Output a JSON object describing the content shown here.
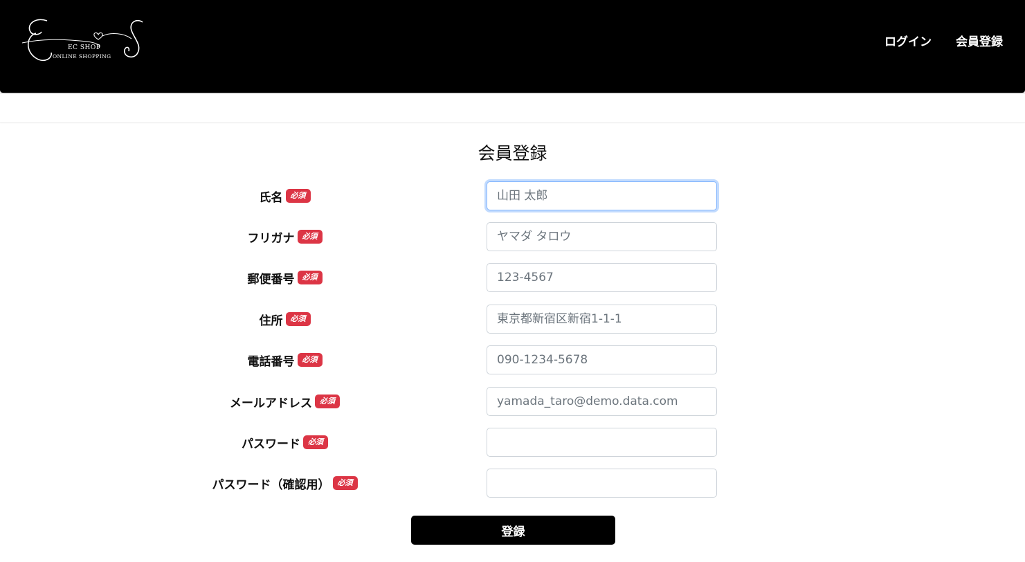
{
  "header": {
    "logo": {
      "main": "EC SHOP",
      "sub": "ONLINE SHOPPING"
    },
    "nav": {
      "login": "ログイン",
      "register": "会員登録"
    }
  },
  "page": {
    "title": "会員登録"
  },
  "form": {
    "required_badge": "必須",
    "fields": [
      {
        "label": "氏名",
        "placeholder": "山田 太郎",
        "value": ""
      },
      {
        "label": "フリガナ",
        "placeholder": "ヤマダ タロウ",
        "value": ""
      },
      {
        "label": "郵便番号",
        "placeholder": "123-4567",
        "value": ""
      },
      {
        "label": "住所",
        "placeholder": "東京都新宿区新宿1-1-1",
        "value": ""
      },
      {
        "label": "電話番号",
        "placeholder": "090-1234-5678",
        "value": ""
      },
      {
        "label": "メールアドレス",
        "placeholder": "yamada_taro@demo.data.com",
        "value": ""
      },
      {
        "label": "パスワード",
        "placeholder": "",
        "value": ""
      },
      {
        "label": "パスワード（確認用）",
        "placeholder": "",
        "value": ""
      }
    ],
    "submit_label": "登録"
  },
  "colors": {
    "header_bg": "#000000",
    "badge_bg": "#dc3545",
    "focus_ring": "#86b7fe"
  },
  "icons": {
    "logo": "ec-shop-logo"
  }
}
